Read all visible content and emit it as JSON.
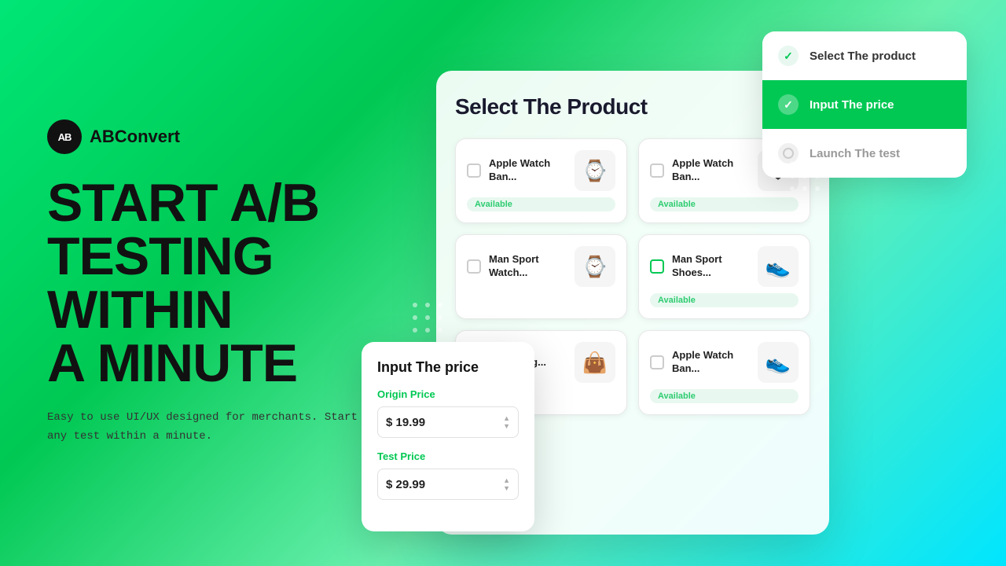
{
  "logo": {
    "icon_text": "AB",
    "name": "ABConvert"
  },
  "hero": {
    "title_line1": "START A/B",
    "title_line2": "TESTING",
    "title_line3": "WITHIN",
    "title_line4": "A MINUTE",
    "subtitle": "Easy to use UI/UX designed for merchants.\nStart any test within a minute."
  },
  "product_panel": {
    "title": "Select The  Product",
    "products": [
      {
        "id": 1,
        "name": "Apple Watch Ban...",
        "badge": "Available",
        "emoji": "⌚",
        "checked": false
      },
      {
        "id": 2,
        "name": "Apple Watch Ban...",
        "badge": "Available",
        "emoji": "⌚",
        "checked": false
      },
      {
        "id": 3,
        "name": "Man Sport Watch...",
        "badge": "",
        "emoji": "⌚",
        "checked": false
      },
      {
        "id": 4,
        "name": "Man Sport Shoes...",
        "badge": "Available",
        "emoji": "👟",
        "checked": false
      },
      {
        "id": 5,
        "name": "Sport Bag...",
        "badge": "",
        "emoji": "👜",
        "checked": false
      },
      {
        "id": 6,
        "name": "Apple Watch Ban...",
        "badge": "Available",
        "emoji": "👟",
        "checked": false
      }
    ]
  },
  "wizard": {
    "steps": [
      {
        "id": 1,
        "label": "Select The product",
        "state": "done",
        "icon": "✓"
      },
      {
        "id": 2,
        "label": "Input The price",
        "state": "active",
        "icon": "✓"
      },
      {
        "id": 3,
        "label": "Launch The test",
        "state": "pending",
        "icon": "○"
      }
    ]
  },
  "price_panel": {
    "title": "Input The price",
    "origin_label": "Origin Price",
    "origin_value": "$ 19.99",
    "test_label": "Test Price",
    "test_value": "$ 29.99"
  },
  "colors": {
    "primary_green": "#00c853",
    "available_green": "#2ecc71",
    "available_bg": "#e8f8f0"
  }
}
